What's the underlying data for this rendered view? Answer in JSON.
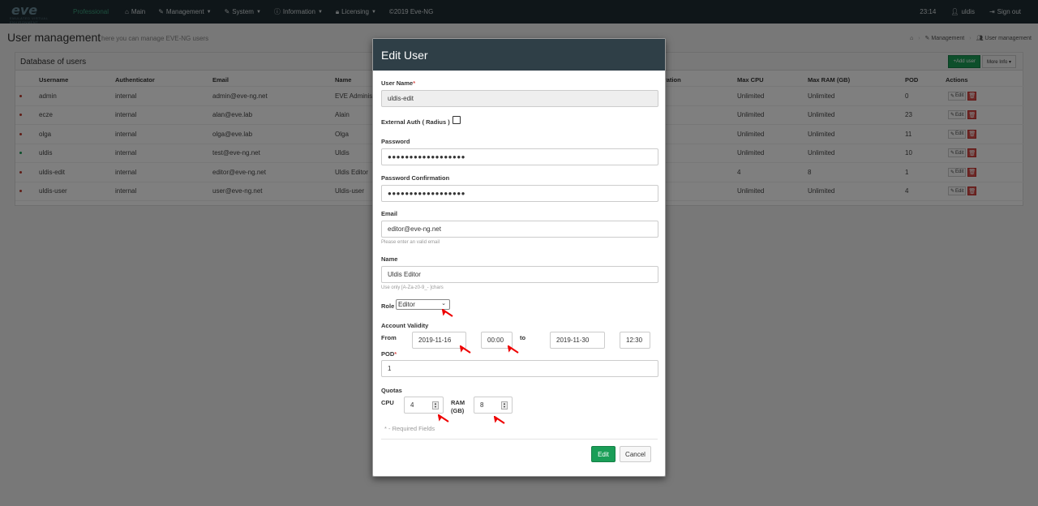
{
  "nav": {
    "logo": "eve",
    "logo_sub": "EMULATED VIRTUAL ENVIRONMENT",
    "brand": "Professional",
    "items": [
      {
        "label": "Main",
        "icon": "home-icon",
        "caret": false
      },
      {
        "label": "Management",
        "icon": "wrench-icon",
        "caret": true
      },
      {
        "label": "System",
        "icon": "wrench-icon",
        "caret": true
      },
      {
        "label": "Information",
        "icon": "info-icon",
        "caret": true
      },
      {
        "label": "Licensing",
        "icon": "lock-icon",
        "caret": true
      },
      {
        "label": "©2019 Eve-NG",
        "icon": "",
        "caret": false
      }
    ],
    "time": "23:14",
    "user": "uldis",
    "signout": "Sign out"
  },
  "page": {
    "title": "User management",
    "subtitle": "here you can manage EVE-NG users",
    "breadcrumb": [
      "Management",
      "User management"
    ]
  },
  "panel": {
    "title": "Database of users",
    "add_user": "+Add user",
    "more_info": "More Info ▾"
  },
  "table": {
    "headers": [
      "Username",
      "Authenticator",
      "Email",
      "Name",
      "Expiration",
      "Max CPU",
      "Max RAM (GB)",
      "POD",
      "Actions"
    ],
    "rows": [
      {
        "status": "red",
        "username": "admin",
        "auth": "internal",
        "email": "admin@eve-ng.net",
        "name": "EVE Administ",
        "cpu": "Unlimited",
        "ram": "Unlimited",
        "pod": "0"
      },
      {
        "status": "red",
        "username": "ecze",
        "auth": "internal",
        "email": "alan@eve.lab",
        "name": "Alain",
        "cpu": "Unlimited",
        "ram": "Unlimited",
        "pod": "23"
      },
      {
        "status": "red",
        "username": "olga",
        "auth": "internal",
        "email": "olga@eve.lab",
        "name": "Olga",
        "cpu": "Unlimited",
        "ram": "Unlimited",
        "pod": "11"
      },
      {
        "status": "green",
        "username": "uldis",
        "auth": "internal",
        "email": "test@eve-ng.net",
        "name": "Uldis",
        "cpu": "Unlimited",
        "ram": "Unlimited",
        "pod": "10"
      },
      {
        "status": "red",
        "username": "uldis-edit",
        "auth": "internal",
        "email": "editor@eve-ng.net",
        "name": "Uldis Editor",
        "cpu": "4",
        "ram": "8",
        "pod": "1"
      },
      {
        "status": "red",
        "username": "uldis-user",
        "auth": "internal",
        "email": "user@eve-ng.net",
        "name": "Uldis-user",
        "cpu": "Unlimited",
        "ram": "Unlimited",
        "pod": "4"
      }
    ],
    "edit_label": "Edit"
  },
  "modal": {
    "title": "Edit User",
    "username_label": "User Name",
    "username_value": "uldis-edit",
    "ext_auth_label": "External Auth ( Radius )",
    "password_label": "Password",
    "password_value": "●●●●●●●●●●●●●●●●●●",
    "password_confirm_label": "Password Confirmation",
    "password_confirm_value": "●●●●●●●●●●●●●●●●●●",
    "email_label": "Email",
    "email_value": "editor@eve-ng.net",
    "email_hint": "Please enter an valid email",
    "name_label": "Name",
    "name_value": "Uldis Editor",
    "name_hint": "Use only [A-Za-z0-9_- ]chars",
    "role_label": "Role",
    "role_value": "Editor",
    "validity_label": "Account Validity",
    "from_label": "From",
    "to_label": "to",
    "from_date": "2019-11-16",
    "from_time": "00:00",
    "to_date": "2019-11-30",
    "to_time": "12:30",
    "pod_label": "POD",
    "pod_value": "1",
    "quotas_label": "Quotas",
    "cpu_label": "CPU",
    "cpu_value": "4",
    "ram_label_1": "RAM",
    "ram_label_2": "(GB)",
    "ram_value": "8",
    "required_note": "* - Required Fields",
    "edit_button": "Edit",
    "cancel_button": "Cancel",
    "required_mark": "*"
  }
}
